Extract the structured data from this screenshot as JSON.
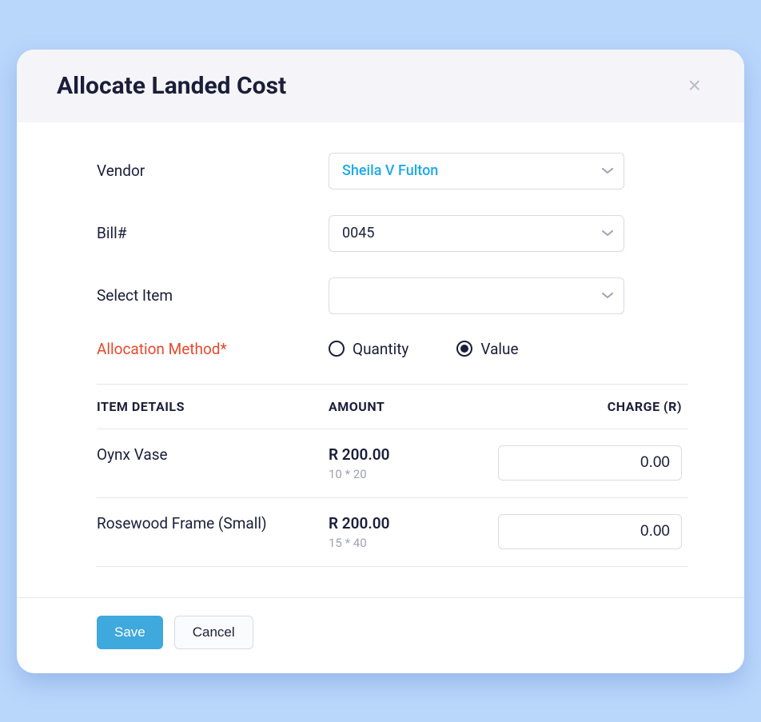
{
  "header": {
    "title": "Allocate Landed Cost"
  },
  "form": {
    "vendor_label": "Vendor",
    "vendor_value": "Sheila V Fulton",
    "bill_label": "Bill#",
    "bill_value": "0045",
    "select_item_label": "Select Item",
    "select_item_value": "",
    "allocation_method_label": "Allocation  Method*",
    "radio_quantity": "Quantity",
    "radio_value": "Value",
    "allocation_method_selected": "value"
  },
  "table": {
    "headers": {
      "item": "ITEM DETAILS",
      "amount": "AMOUNT",
      "charge": "CHARGE (R)"
    },
    "rows": [
      {
        "item_name": "Oynx Vase",
        "amount": "R 200.00",
        "calc": "10 * 20",
        "charge": "0.00"
      },
      {
        "item_name": "Rosewood Frame (Small)",
        "amount": "R 200.00",
        "calc": "15 * 40",
        "charge": "0.00"
      }
    ]
  },
  "footer": {
    "save": "Save",
    "cancel": "Cancel"
  }
}
